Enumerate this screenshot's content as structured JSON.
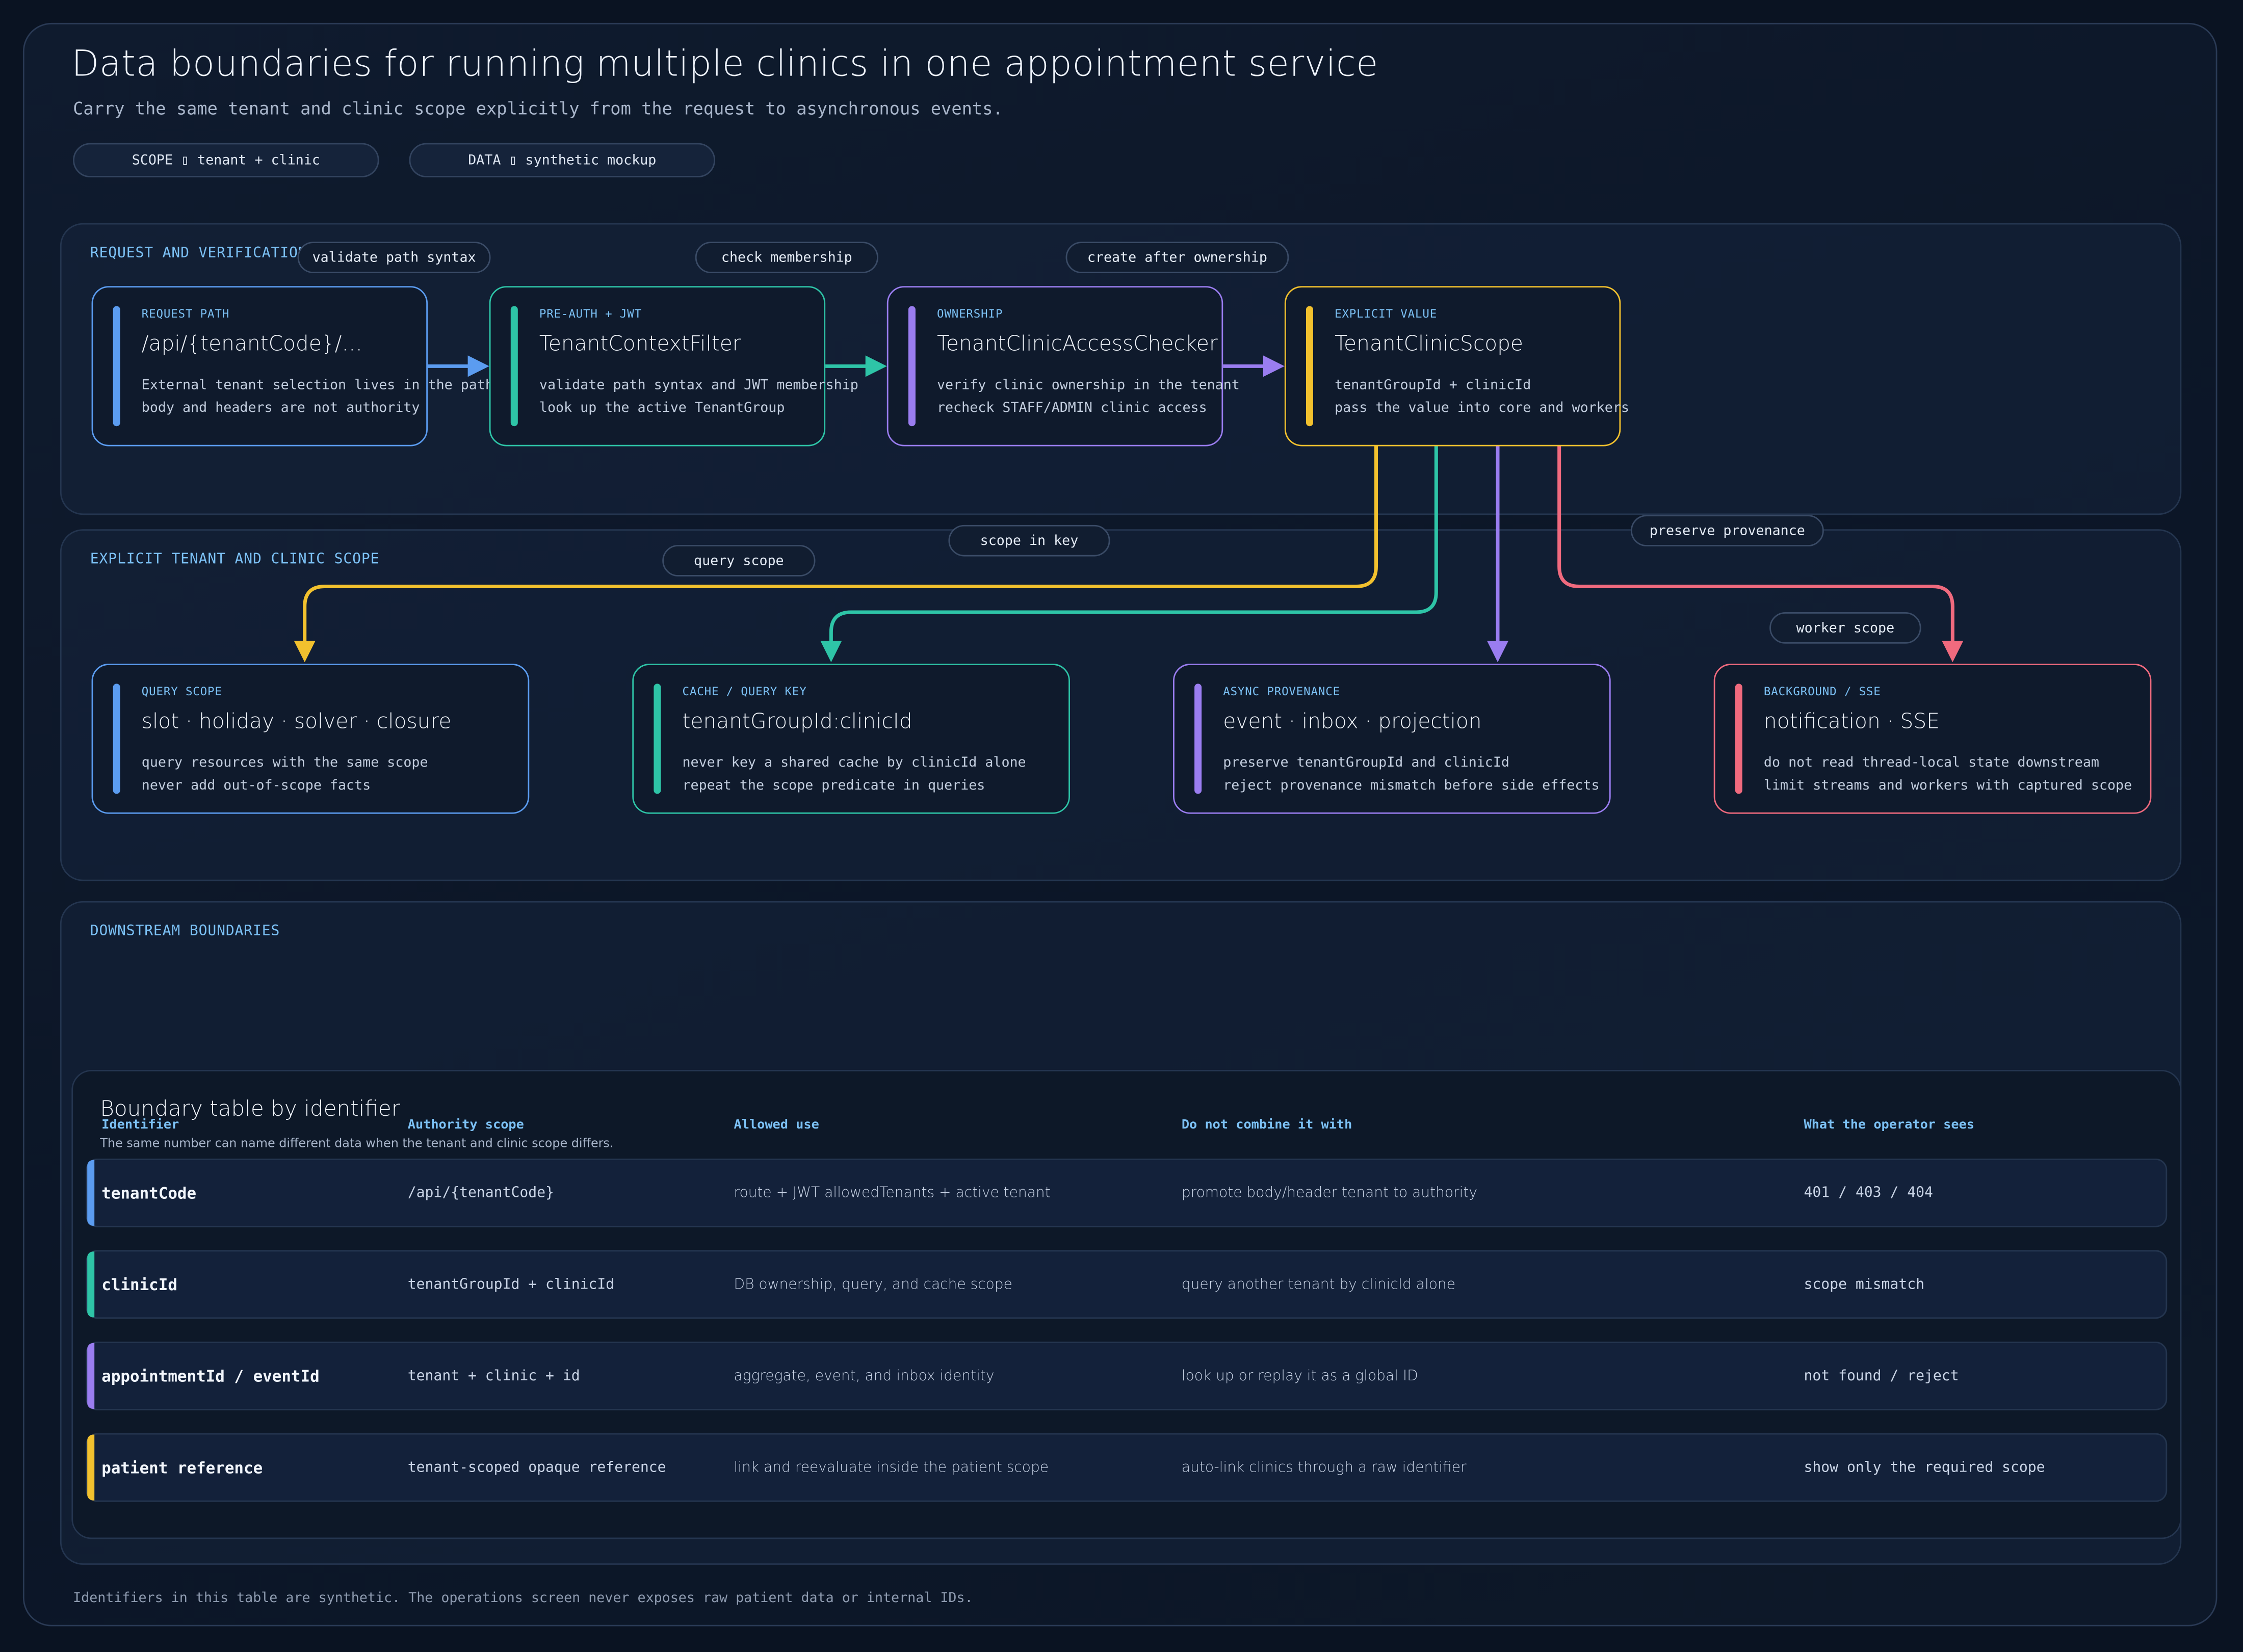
{
  "header": {
    "title": "Data boundaries for running multiple clinics in one appointment service",
    "subtitle": "Carry the same tenant and clinic scope explicitly from the request to asynchronous events.",
    "chips": [
      "SCOPE ▯ tenant + clinic",
      "DATA ▯ synthetic mockup"
    ]
  },
  "panels": {
    "request": "REQUEST AND VERIFICATION",
    "scope": "EXPLICIT TENANT AND CLINIC SCOPE",
    "downstream": "DOWNSTREAM BOUNDARIES"
  },
  "edge_labels": {
    "validate": "validate path syntax",
    "membership": "check membership",
    "create": "create after ownership",
    "query": "query scope",
    "key": "scope in key",
    "provenance": "preserve provenance",
    "worker": "worker scope"
  },
  "nodes": [
    {
      "tag": "REQUEST PATH",
      "title": "/api/{tenantCode}/…",
      "line1": "External tenant selection lives in the path",
      "line2": "body and headers are not authority",
      "color": "#5b9cf0"
    },
    {
      "tag": "PRE-AUTH + JWT",
      "title": "TenantContextFilter",
      "line1": "validate path syntax and JWT membership",
      "line2": "look up the active TenantGroup",
      "color": "#2ec4a7"
    },
    {
      "tag": "OWNERSHIP",
      "title": "TenantClinicAccessChecker",
      "line1": "verify clinic ownership in the tenant",
      "line2": "recheck STAFF/ADMIN clinic access",
      "color": "#9a7df0"
    },
    {
      "tag": "EXPLICIT VALUE",
      "title": "TenantClinicScope",
      "line1": "tenantGroupId + clinicId",
      "line2": "pass the value into core and workers",
      "color": "#f2c12e"
    },
    {
      "tag": "QUERY SCOPE",
      "title": "slot · holiday · solver · closure",
      "line1": "query resources with the same scope",
      "line2": "never add out-of-scope facts",
      "color": "#5b9cf0"
    },
    {
      "tag": "CACHE / QUERY KEY",
      "title": "tenantGroupId:clinicId",
      "line1": "never key a shared cache by clinicId alone",
      "line2": "repeat the scope predicate in queries",
      "color": "#2ec4a7"
    },
    {
      "tag": "ASYNC PROVENANCE",
      "title": "event · inbox · projection",
      "line1": "preserve tenantGroupId and clinicId",
      "line2": "reject provenance mismatch before side effects",
      "color": "#9a7df0"
    },
    {
      "tag": "BACKGROUND / SSE",
      "title": "notification · SSE",
      "line1": "do not read thread-local state downstream",
      "line2": "limit streams and workers with captured scope",
      "color": "#f06a7e"
    }
  ],
  "table": {
    "title": "Boundary table by identifier",
    "subtitle": "The same number can name different data when the tenant and clinic scope differs.",
    "headers": [
      "Identifier",
      "Authority scope",
      "Allowed use",
      "Do not combine it with",
      "What the operator sees"
    ],
    "rows": [
      {
        "id": "tenantCode",
        "scope": "/api/{tenantCode}",
        "allowed": "route + JWT allowedTenants + active tenant",
        "avoid": "promote body/header tenant to authority",
        "sees": "401 / 403 / 404",
        "color": "#5b9cf0"
      },
      {
        "id": "clinicId",
        "scope": "tenantGroupId + clinicId",
        "allowed": "DB ownership, query, and cache scope",
        "avoid": "query another tenant by clinicId alone",
        "sees": "scope mismatch",
        "color": "#2ec4a7"
      },
      {
        "id": "appointmentId / eventId",
        "scope": "tenant + clinic + id",
        "allowed": "aggregate, event, and inbox identity",
        "avoid": "look up or replay it as a global ID",
        "sees": "not found / reject",
        "color": "#9a7df0"
      },
      {
        "id": "patient reference",
        "scope": "tenant-scoped opaque reference",
        "allowed": "link and reevaluate inside the patient scope",
        "avoid": "auto-link clinics through a raw identifier",
        "sees": "show only the required scope",
        "color": "#f2c12e"
      }
    ]
  },
  "footer": "Identifiers in this table are synthetic. The operations screen never exposes raw patient data or internal IDs."
}
